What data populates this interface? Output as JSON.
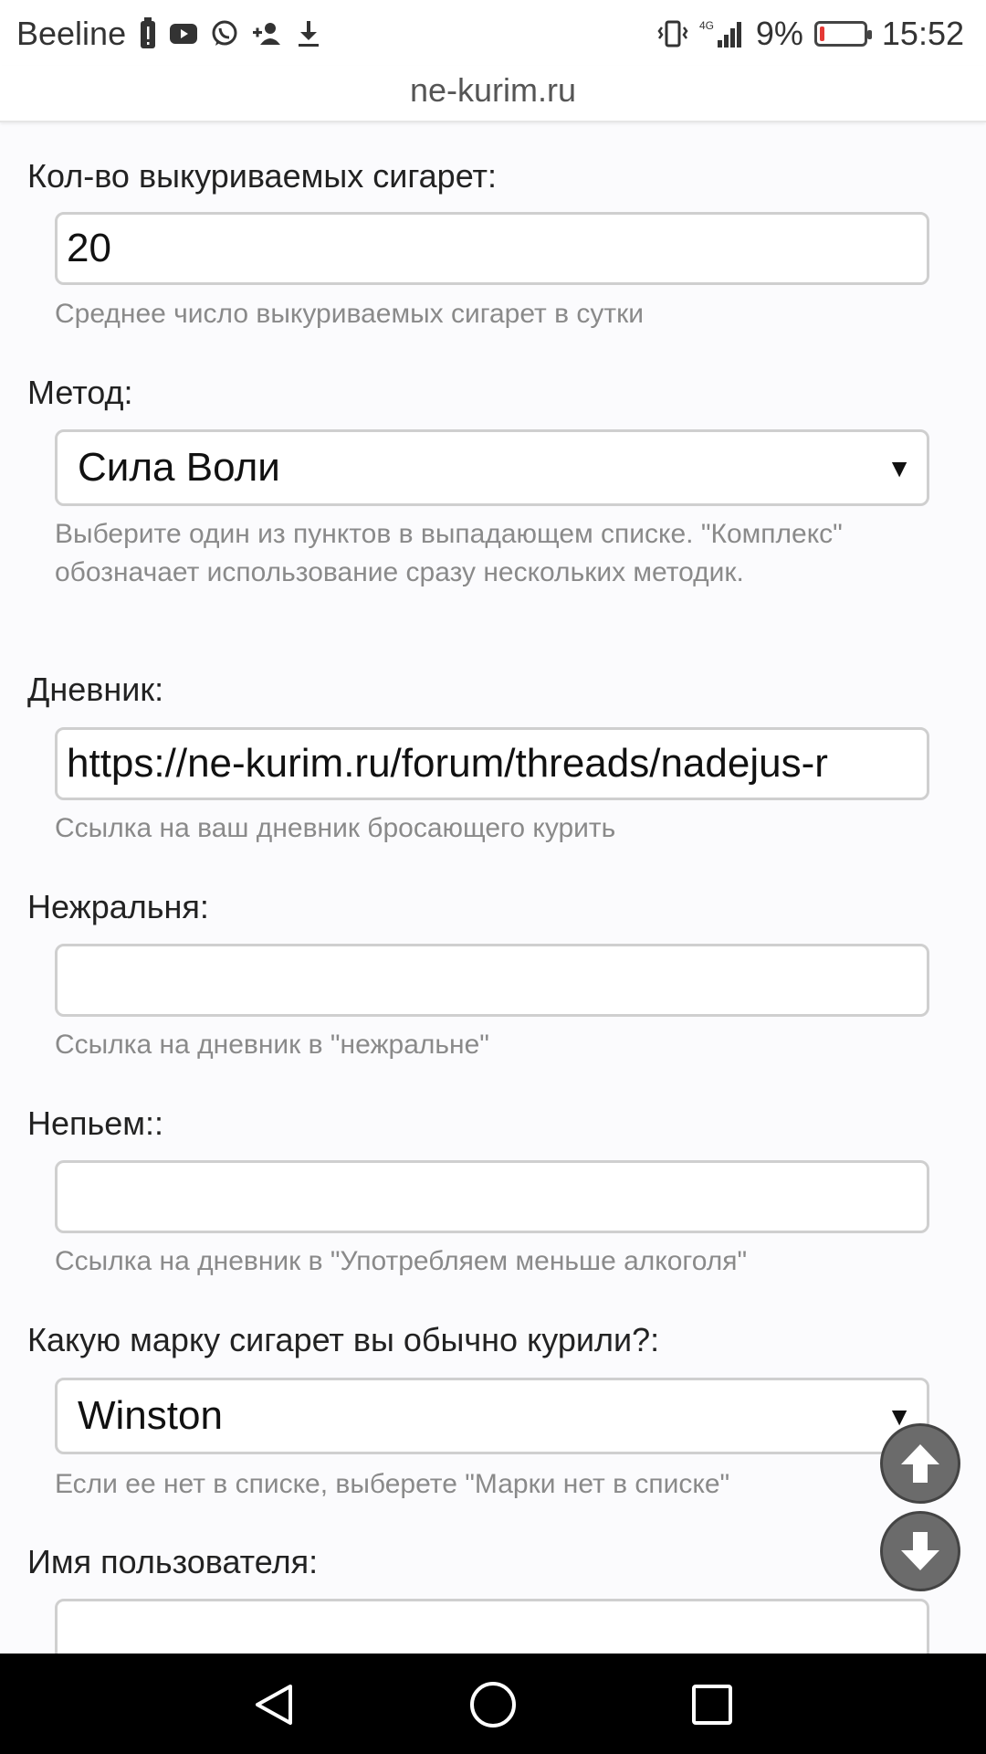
{
  "status_bar": {
    "carrier": "Beeline",
    "network": "4G",
    "battery_percent": "9%",
    "time": "15:52",
    "icons": [
      "battery-alert-icon",
      "youtube-icon",
      "whatsapp-icon",
      "add-contact-icon",
      "download-icon",
      "vibrate-icon",
      "signal-icon"
    ]
  },
  "browser": {
    "url": "ne-kurim.ru"
  },
  "form": {
    "cigarettes": {
      "label": "Кол-во выкуриваемых сигарет:",
      "value": "20",
      "hint": "Среднее число выкуриваемых сигарет в сутки"
    },
    "method": {
      "label": "Метод:",
      "selected": "Сила Воли",
      "hint": "Выберите один из пунктов в выпадающем списке. \"Комплекс\" обозначает использование сразу нескольких методик."
    },
    "diary": {
      "label": "Дневник:",
      "value": "https://ne-kurim.ru/forum/threads/nadejus-r",
      "hint": "Ссылка на ваш дневник бросающего курить"
    },
    "nezhralnya": {
      "label": "Нежральня:",
      "value": "",
      "hint": "Ссылка на дневник в \"нежральне\""
    },
    "nepyem": {
      "label": "Непьем::",
      "value": "",
      "hint": "Ссылка на дневник в \"Употребляем меньше алкоголя\""
    },
    "brand": {
      "label": "Какую марку сигарет вы обычно курили?:",
      "selected": "Winston",
      "hint": "Если ее нет в списке, выберете \"Марки нет в списке\""
    },
    "username": {
      "label": "Имя пользователя:",
      "value": ""
    }
  },
  "colors": {
    "page_bg": "#fbfbfd",
    "field_border": "#cfcfcf",
    "hint_text": "#8a8a8a",
    "fab_bg": "#6b6b6b",
    "battery_low": "#e53935"
  }
}
